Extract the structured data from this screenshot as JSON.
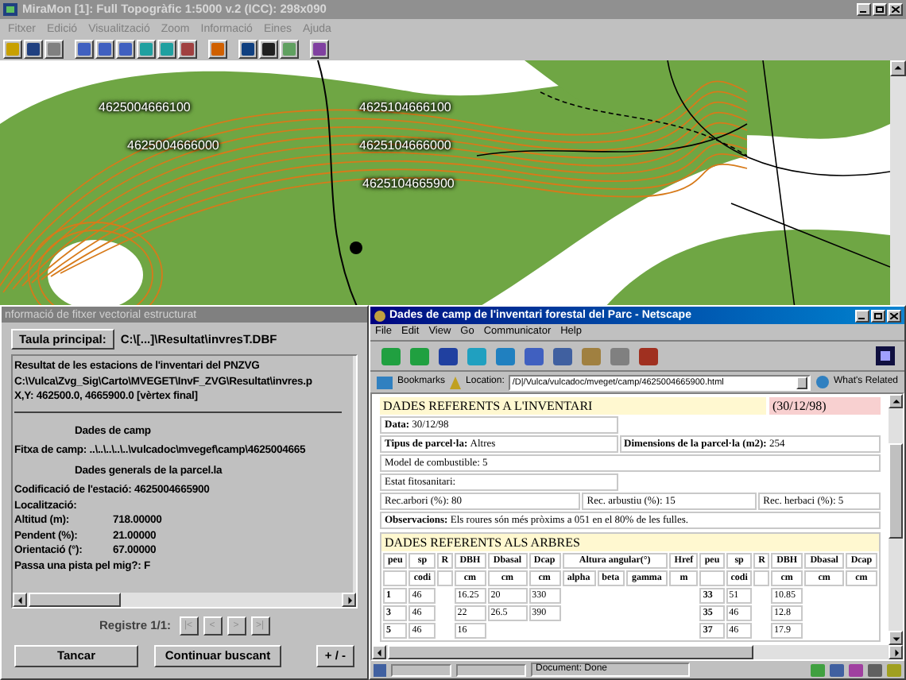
{
  "main_window": {
    "title": "MiraMon [1]: Full Topogràfic 1:5000 v.2 (ICC): 298x090",
    "menu": [
      "Fitxer",
      "Edició",
      "Visualització",
      "Zoom",
      "Informació",
      "Eines",
      "Ajuda"
    ],
    "map": {
      "labels": [
        {
          "text": "4625004666100",
          "kind": "upper_left"
        },
        {
          "text": "4625104666100",
          "kind": "upper_right"
        },
        {
          "text": "4625004666000",
          "kind": "middle_left"
        },
        {
          "text": "4625104666000",
          "kind": "middle_right"
        },
        {
          "text": "4625104665900",
          "kind": "lower_right"
        }
      ]
    }
  },
  "info_dialog": {
    "title": "nformació de fitxer vectorial estructurat",
    "table_button": "Taula principal:",
    "table_path": "C:\\[...]\\Resultat\\invresT.DBF",
    "lines": [
      {
        "kind": "text",
        "text": "Resultat de les estacions de l'inventari del PNZVG"
      },
      {
        "kind": "text",
        "text": "C:\\Vulca\\Zvg_Sig\\Carto\\MVEGET\\InvF_ZVG\\Resultat\\invres.p"
      },
      {
        "kind": "text",
        "text": "X,Y: 462500.0, 4665900.0 [vèrtex final]"
      },
      {
        "kind": "rule"
      },
      {
        "kind": "heading",
        "text": "Dades de camp"
      },
      {
        "kind": "text",
        "text": "Fitxa de camp: ..\\..\\..\\..\\..\\vulcadoc\\mvegef\\camp\\4625004665"
      },
      {
        "kind": "heading",
        "text": "Dades generals de la parcel.la"
      },
      {
        "kind": "text",
        "text": "Codificació de l'estació: 4625004665900"
      },
      {
        "kind": "text",
        "text": "Localització:"
      },
      {
        "kind": "field",
        "label": "Altitud (m):",
        "value": "718.00000"
      },
      {
        "kind": "field",
        "label": "Pendent (%):",
        "value": "21.00000"
      },
      {
        "kind": "field",
        "label": "Orientació (°):",
        "value": "67.00000"
      },
      {
        "kind": "text",
        "text": "Passa una pista pel mig?: F"
      }
    ],
    "record_label": "Registre 1/1:",
    "nav": [
      "|<",
      "<",
      ">",
      ">|"
    ],
    "buttons": [
      "Tancar",
      "Continuar buscant",
      "+ / -"
    ]
  },
  "browser": {
    "title": "Dades de camp de l'inventari forestal del Parc - Netscape",
    "menu": [
      "File",
      "Edit",
      "View",
      "Go",
      "Communicator",
      "Help"
    ],
    "bookmarks": "Bookmarks",
    "location_label": "Location:",
    "url": "/D|/Vulca/vulcadoc/mveget/camp/4625004665900.html",
    "related": "What's Related",
    "inventory": {
      "title": "DADES REFERENTS A L'INVENTARI",
      "date": "(30/12/98)",
      "rows": [
        [
          {
            "label": "Data:",
            "value": "30/12/98"
          }
        ],
        [
          {
            "label": "Tipus de parcel·la:",
            "value": "Altres"
          },
          {
            "label": "Dimensions de la parcel·la (m2):",
            "value": "254"
          }
        ],
        [
          {
            "value": "Model de combustible: 5"
          }
        ],
        [
          {
            "value": "Estat fitosanitari:"
          }
        ],
        [
          {
            "value": "Rec.arbori (%): 80"
          },
          {
            "value": "Rec. arbustiu (%): 15"
          },
          {
            "value": "Rec. herbaci (%): 5"
          }
        ],
        [
          {
            "label": "Observacions:",
            "value": "Els roures són més pròxims a 051 en el 80% de les fulles."
          }
        ]
      ]
    },
    "trees": {
      "title": "DADES REFERENTS ALS ARBRES",
      "columns": [
        {
          "label": "peu"
        },
        {
          "label": "sp",
          "unit": "codi"
        },
        {
          "label": "R"
        },
        {
          "label": "DBH",
          "unit": "cm"
        },
        {
          "label": "Dbasal",
          "unit": "cm"
        },
        {
          "label": "Dcap",
          "unit": "cm"
        },
        {
          "label": "Altura angular(°)",
          "unit": "alpha"
        },
        {
          "unit": "beta"
        },
        {
          "unit": "gamma"
        },
        {
          "label": "Href",
          "unit": "m"
        },
        {
          "label": "peu"
        },
        {
          "label": "sp",
          "unit": "codi"
        },
        {
          "label": "R"
        },
        {
          "label": "DBH",
          "unit": "cm"
        },
        {
          "label": "Dbasal",
          "unit": "cm"
        },
        {
          "label": "Dcap",
          "unit": "cm"
        }
      ],
      "rows": [
        [
          "1",
          "46",
          null,
          "16.25",
          "20",
          "330",
          null,
          null,
          null,
          null,
          "33",
          "51",
          null,
          "10.85",
          null,
          null
        ],
        [
          "3",
          "46",
          null,
          "22",
          "26.5",
          "390",
          null,
          null,
          null,
          null,
          "35",
          "46",
          null,
          "12.8",
          null,
          null
        ],
        [
          "5",
          "46",
          null,
          "16",
          null,
          null,
          null,
          null,
          null,
          null,
          "37",
          "46",
          null,
          "17.9",
          null,
          null
        ]
      ]
    },
    "status": "Document: Done"
  }
}
